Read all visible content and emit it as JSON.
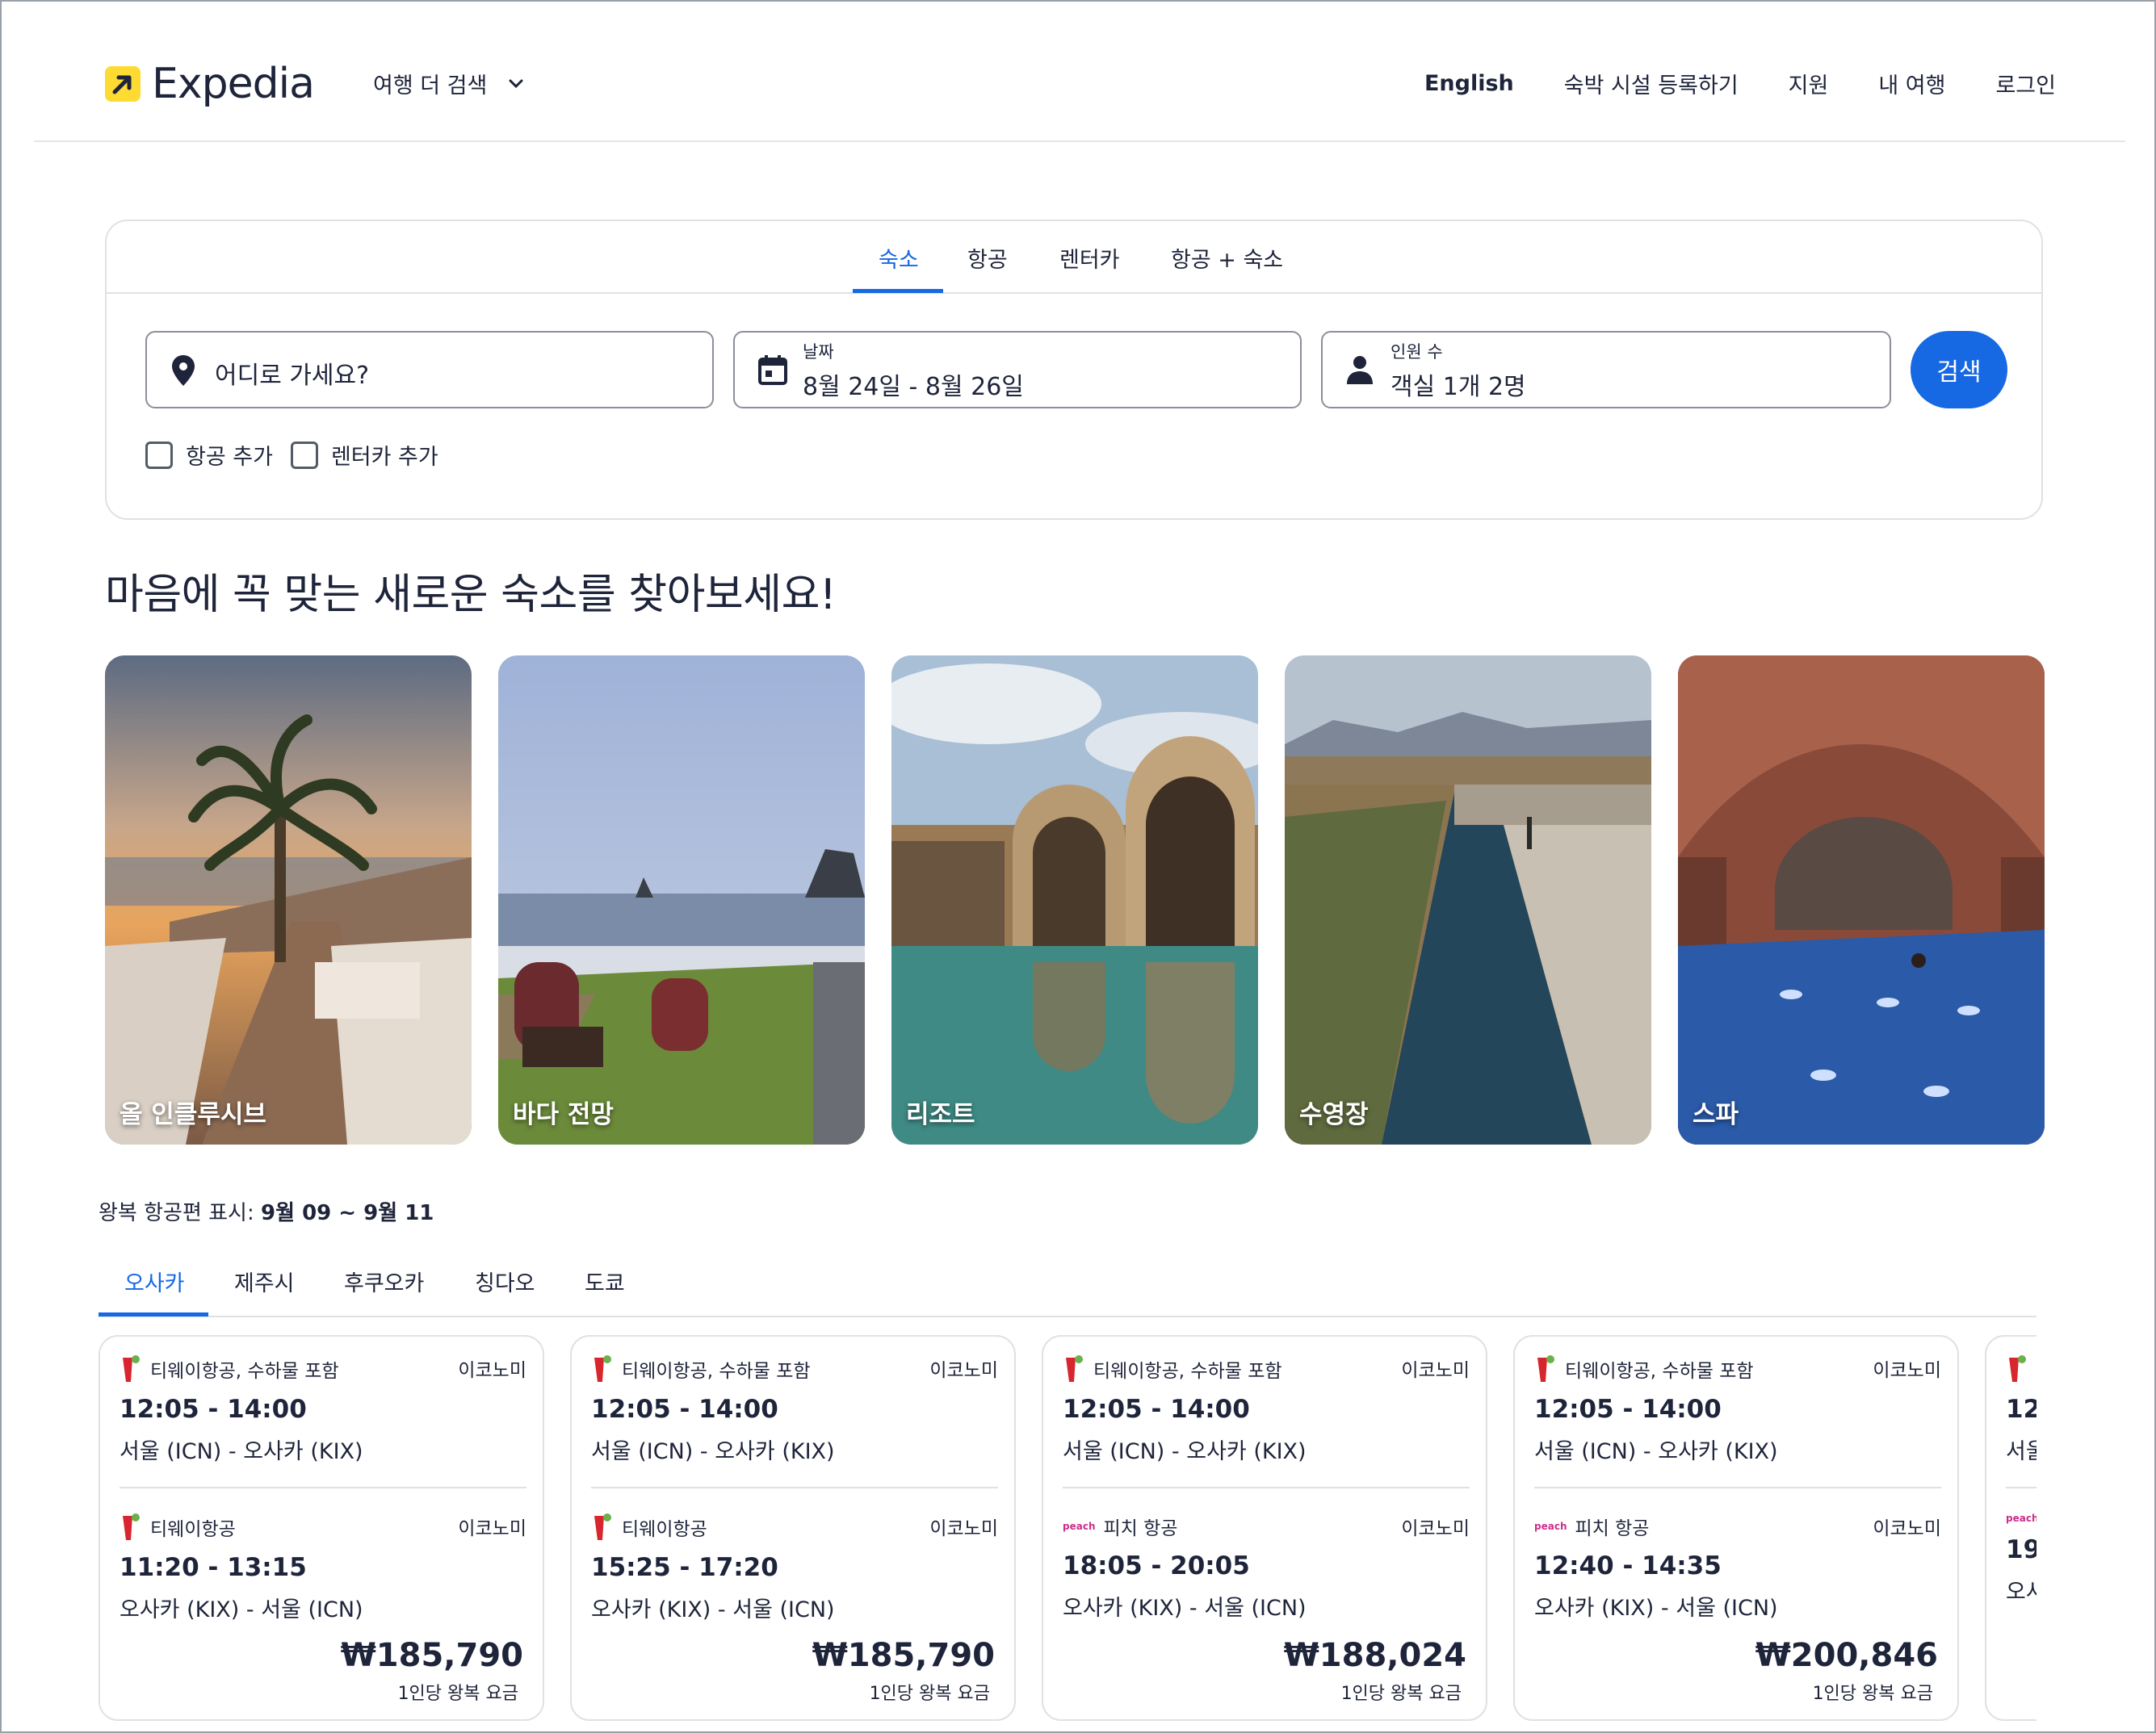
{
  "header": {
    "brand": "Expedia",
    "more_search": "여행 더 검색",
    "nav": {
      "english": "English",
      "list_property": "숙박 시설 등록하기",
      "support": "지원",
      "my_trips": "내 여행",
      "login": "로그인"
    }
  },
  "search": {
    "tabs": [
      "숙소",
      "항공",
      "렌터카",
      "항공 + 숙소"
    ],
    "destination_placeholder": "어디로 가세요?",
    "date_label": "날짜",
    "date_value": "8월 24일 - 8월 26일",
    "guests_label": "인원 수",
    "guests_value": "객실 1개 2명",
    "search_button": "검색",
    "add_flight": "항공 추가",
    "add_car": "렌터카 추가"
  },
  "headline": "마음에 꼭 맞는 새로운 숙소를 찾아보세요!",
  "tiles": [
    {
      "label": "올 인클루시브"
    },
    {
      "label": "바다 전망"
    },
    {
      "label": "리조트"
    },
    {
      "label": "수영장"
    },
    {
      "label": "스파"
    }
  ],
  "flights": {
    "heading_prefix": "왕복 항공편 표시:",
    "heading_dates": "9월 09 ~ 9월 11",
    "city_tabs": [
      "오사카",
      "제주시",
      "후쿠오카",
      "칭다오",
      "도쿄"
    ],
    "cards": [
      {
        "out_airline": "티웨이항공, 수하물 포함",
        "out_class": "이코노미",
        "out_time": "12:05 - 14:00",
        "out_route": "서울 (ICN) - 오사카 (KIX)",
        "ret_airline": "티웨이항공",
        "ret_class": "이코노미",
        "ret_time": "11:20 - 13:15",
        "ret_route": "오사카 (KIX) - 서울 (ICN)",
        "price": "₩185,790",
        "price_note": "1인당 왕복 요금"
      },
      {
        "out_airline": "티웨이항공, 수하물 포함",
        "out_class": "이코노미",
        "out_time": "12:05 - 14:00",
        "out_route": "서울 (ICN) - 오사카 (KIX)",
        "ret_airline": "티웨이항공",
        "ret_class": "이코노미",
        "ret_time": "15:25 - 17:20",
        "ret_route": "오사카 (KIX) - 서울 (ICN)",
        "price": "₩185,790",
        "price_note": "1인당 왕복 요금"
      },
      {
        "out_airline": "티웨이항공, 수하물 포함",
        "out_class": "이코노미",
        "out_time": "12:05 - 14:00",
        "out_route": "서울 (ICN) - 오사카 (KIX)",
        "ret_airline": "피치 항공",
        "ret_class": "이코노미",
        "ret_time": "18:05 - 20:05",
        "ret_route": "오사카 (KIX) - 서울 (ICN)",
        "price": "₩188,024",
        "price_note": "1인당 왕복 요금"
      },
      {
        "out_airline": "티웨이항공, 수하물 포함",
        "out_class": "이코노미",
        "out_time": "12:05 - 14:00",
        "out_route": "서울 (ICN) - 오사카 (KIX)",
        "ret_airline": "피치 항공",
        "ret_class": "이코노미",
        "ret_time": "12:40 - 14:35",
        "ret_route": "오사카 (KIX) - 서울 (ICN)",
        "price": "₩200,846",
        "price_note": "1인당 왕복 요금"
      },
      {
        "out_time_partial": "12:",
        "out_route_partial": "서울",
        "ret_time_partial": "19:",
        "ret_route_partial": "오사"
      }
    ],
    "peach_logo": "peach"
  },
  "colors": {
    "accent": "#1668e3",
    "brand_yellow": "#fddb32",
    "text": "#1e243a",
    "border": "#dfe1e5"
  }
}
